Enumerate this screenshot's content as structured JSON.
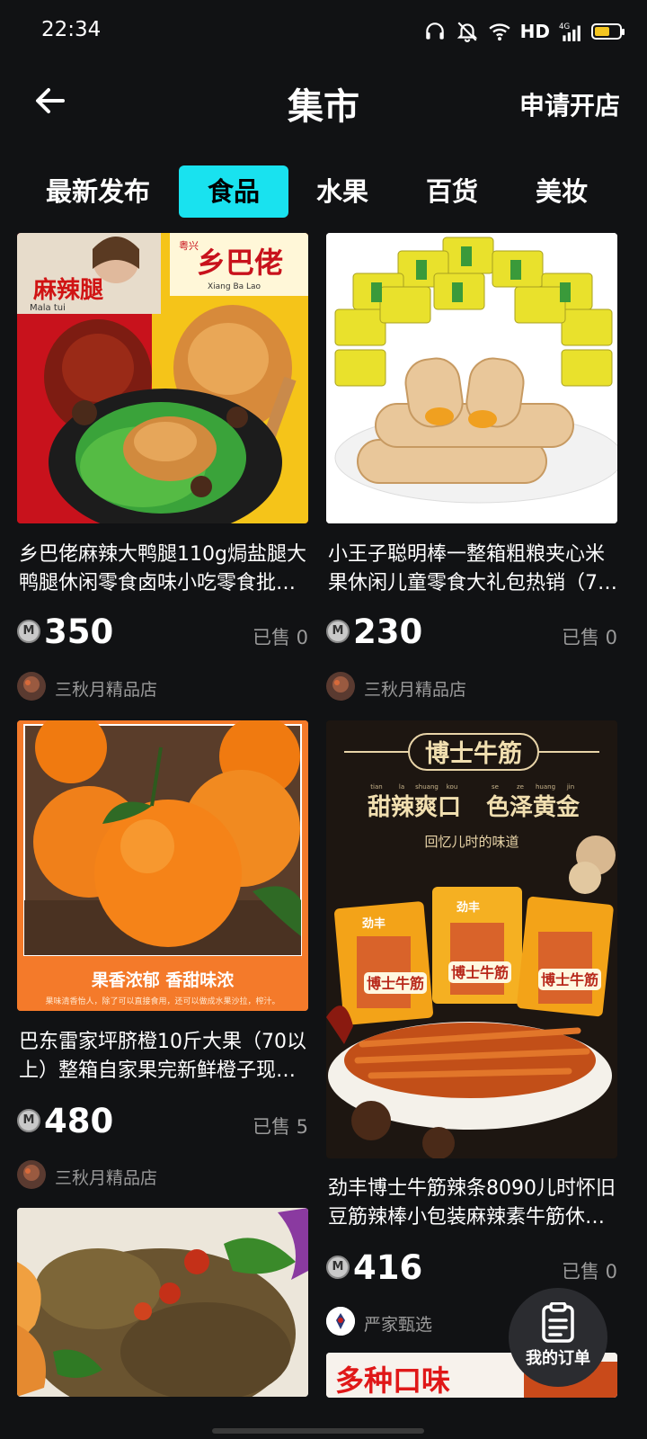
{
  "status_bar": {
    "time": "22:34",
    "network": "HD",
    "signal": "4G",
    "battery_percent": 0.6
  },
  "header": {
    "title": "集市",
    "action": "申请开店",
    "back_icon": "arrow-left-icon"
  },
  "tabs": [
    {
      "label": "最新发布",
      "active": false
    },
    {
      "label": "食品",
      "active": true
    },
    {
      "label": "水果",
      "active": false
    },
    {
      "label": "百货",
      "active": false
    },
    {
      "label": "美妆",
      "active": false
    }
  ],
  "accent_color": "#19e2ef",
  "products": [
    {
      "name_line1": "乡巴佬麻辣大鸭腿110g焗盐腿大",
      "name_line2": "鸭腿休闲零食卤味小吃零食批…",
      "price": "350",
      "sold": "已售 0",
      "shop": "三秋月精品店",
      "image_text": {
        "brand": "乡巴佬",
        "brand_pinyin": "Xiang Ba Lao",
        "label": "麻辣腿",
        "maker": "粤兴",
        "label_pinyin": "Mala tui"
      }
    },
    {
      "name_line1": "小王子聪明棒一整箱粗粮夹心米",
      "name_line2": "果休闲儿童零食大礼包热销（7…",
      "price": "230",
      "sold": "已售 0",
      "shop": "三秋月精品店"
    },
    {
      "name_line1": "巴东雷家坪脐橙10斤大果（70以",
      "name_line2": "上）整箱自家果完新鲜橙子现…",
      "price": "480",
      "sold": "已售 5",
      "shop": "三秋月精品店",
      "image_text": {
        "slogan": "果香浓郁 香甜味浓",
        "caption": "果味清香怡人，除了可以直接食用，还可以做成水果沙拉，榨汁。"
      }
    },
    {
      "name_line1": "劲丰博士牛筋辣条8090儿时怀旧",
      "name_line2": "豆筋辣棒小包装麻辣素牛筋休…",
      "price": "416",
      "sold": "已售 0",
      "shop": "严家甄选",
      "image_text": {
        "banner": "博士牛筋",
        "pinyin": [
          "tian",
          "la",
          "shuang",
          "kou",
          "se",
          "ze",
          "huang",
          "jin"
        ],
        "headline_left": "甜辣爽口",
        "headline_right": "色泽黄金",
        "subline": "回忆儿时的味道",
        "brand": "劲丰",
        "pack": "博士牛筋"
      }
    },
    {
      "image_text": {
        "banner": "多种口味"
      }
    }
  ],
  "fab": {
    "label": "我的订单",
    "icon": "clipboard-icon"
  }
}
